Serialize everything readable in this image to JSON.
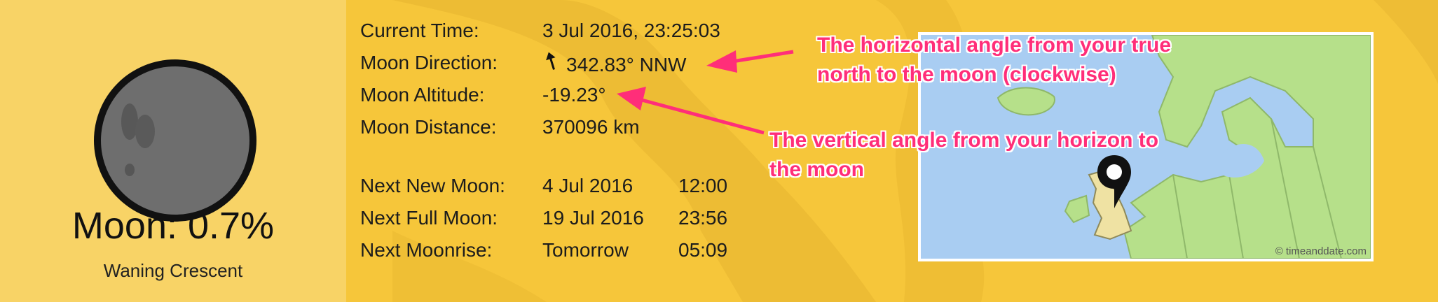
{
  "moon": {
    "percent_label": "Moon: 0.7%",
    "phase": "Waning Crescent"
  },
  "info": {
    "rows": [
      {
        "label": "Current Time:",
        "value": "3 Jul 2016, 23:25:03"
      },
      {
        "label": "Moon Direction:",
        "value": "342.83° NNW"
      },
      {
        "label": "Moon Altitude:",
        "value": "-19.23°"
      },
      {
        "label": "Moon Distance:",
        "value": "370096 km"
      }
    ],
    "events": [
      {
        "label": "Next New Moon:",
        "date": "4 Jul 2016",
        "time": "12:00"
      },
      {
        "label": "Next Full Moon:",
        "date": "19 Jul 2016",
        "time": "23:56"
      },
      {
        "label": "Next Moonrise:",
        "date": "Tomorrow",
        "time": "05:09"
      }
    ]
  },
  "map": {
    "credit": "© timeanddate.com"
  },
  "annotations": {
    "direction_line1": "The horizontal angle from your true",
    "direction_line2": "north to the moon (clockwise)",
    "altitude_line1": "The vertical angle from your horizon to",
    "altitude_line2": "the moon"
  },
  "colors": {
    "background": "#f6c63a",
    "panel": "#f8d366",
    "annotation": "#ff2e79"
  }
}
